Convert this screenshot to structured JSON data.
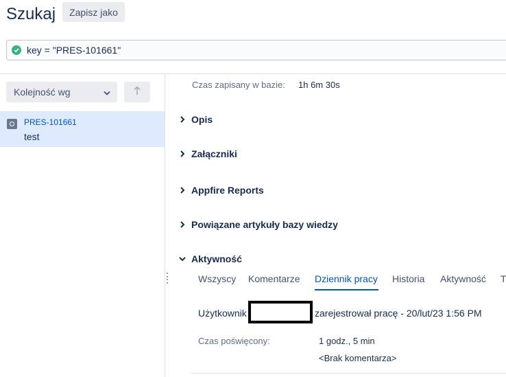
{
  "header": {
    "title": "Szukaj",
    "save_as_label": "Zapisz jako"
  },
  "query": {
    "status_icon": "check-circle-icon",
    "text": "key = \"PRES-101661\""
  },
  "sidebar": {
    "order_label": "Kolejność wg",
    "sort_icon": "arrow-up-icon",
    "results": [
      {
        "key": "PRES-101661",
        "summary": "test",
        "selected": true
      }
    ]
  },
  "detail": {
    "time_logged": {
      "label": "Czas zapisany w bazie:",
      "value": "1h 6m 30s"
    },
    "sections": [
      {
        "label": "Opis",
        "expanded": false
      },
      {
        "label": "Załączniki",
        "expanded": false
      },
      {
        "label": "Appfire Reports",
        "expanded": false
      },
      {
        "label": "Powiązane artykuły bazy wiedzy",
        "expanded": false
      },
      {
        "label": "Aktywność",
        "expanded": true
      }
    ],
    "activity_tabs": [
      {
        "label": "Wszyscy",
        "active": false
      },
      {
        "label": "Komentarze",
        "active": false
      },
      {
        "label": "Dziennik pracy",
        "active": true
      },
      {
        "label": "Historia",
        "active": false
      },
      {
        "label": "Aktywność",
        "active": false
      },
      {
        "label": "Tr",
        "active": false
      }
    ],
    "worklog": {
      "user_label": "Użytkownik",
      "action": "zarejestrował pracę - 20/lut/23 1:56 PM",
      "time_spent_label": "Czas poświęcony:",
      "time_spent_value": "1 godz., 5 min",
      "comment": "<Brak komentarza>"
    }
  },
  "colors": {
    "link": "#0052cc",
    "selected_row": "#deebff",
    "success": "#36b37e"
  }
}
